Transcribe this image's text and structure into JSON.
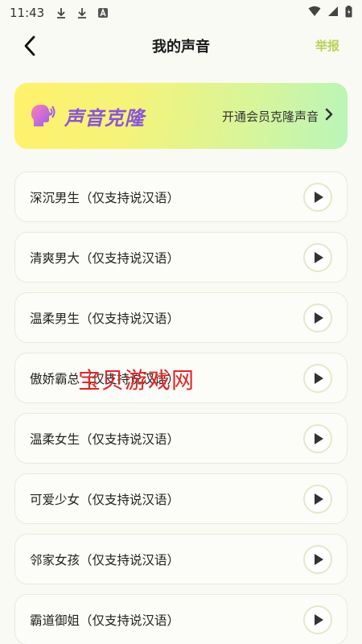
{
  "status_bar": {
    "time": "11:43"
  },
  "header": {
    "title": "我的声音",
    "report_label": "举报"
  },
  "banner": {
    "title": "声音克隆",
    "cta": "开通会员克隆声音"
  },
  "voices": [
    {
      "name": "深沉男生（仅支持说汉语）"
    },
    {
      "name": "清爽男大（仅支持说汉语）"
    },
    {
      "name": "温柔男生（仅支持说汉语）"
    },
    {
      "name": "傲娇霸总（仅支持说汉语）"
    },
    {
      "name": "温柔女生（仅支持说汉语）"
    },
    {
      "name": "可爱少女（仅支持说汉语）"
    },
    {
      "name": "邻家女孩（仅支持说汉语）"
    },
    {
      "name": "霸道御姐（仅支持说汉语）"
    }
  ],
  "watermark": {
    "text": "宝贝游戏网"
  },
  "colors": {
    "accent": "#b7d35a",
    "banner_title": "#8a55d8",
    "watermark": "#e32626"
  }
}
